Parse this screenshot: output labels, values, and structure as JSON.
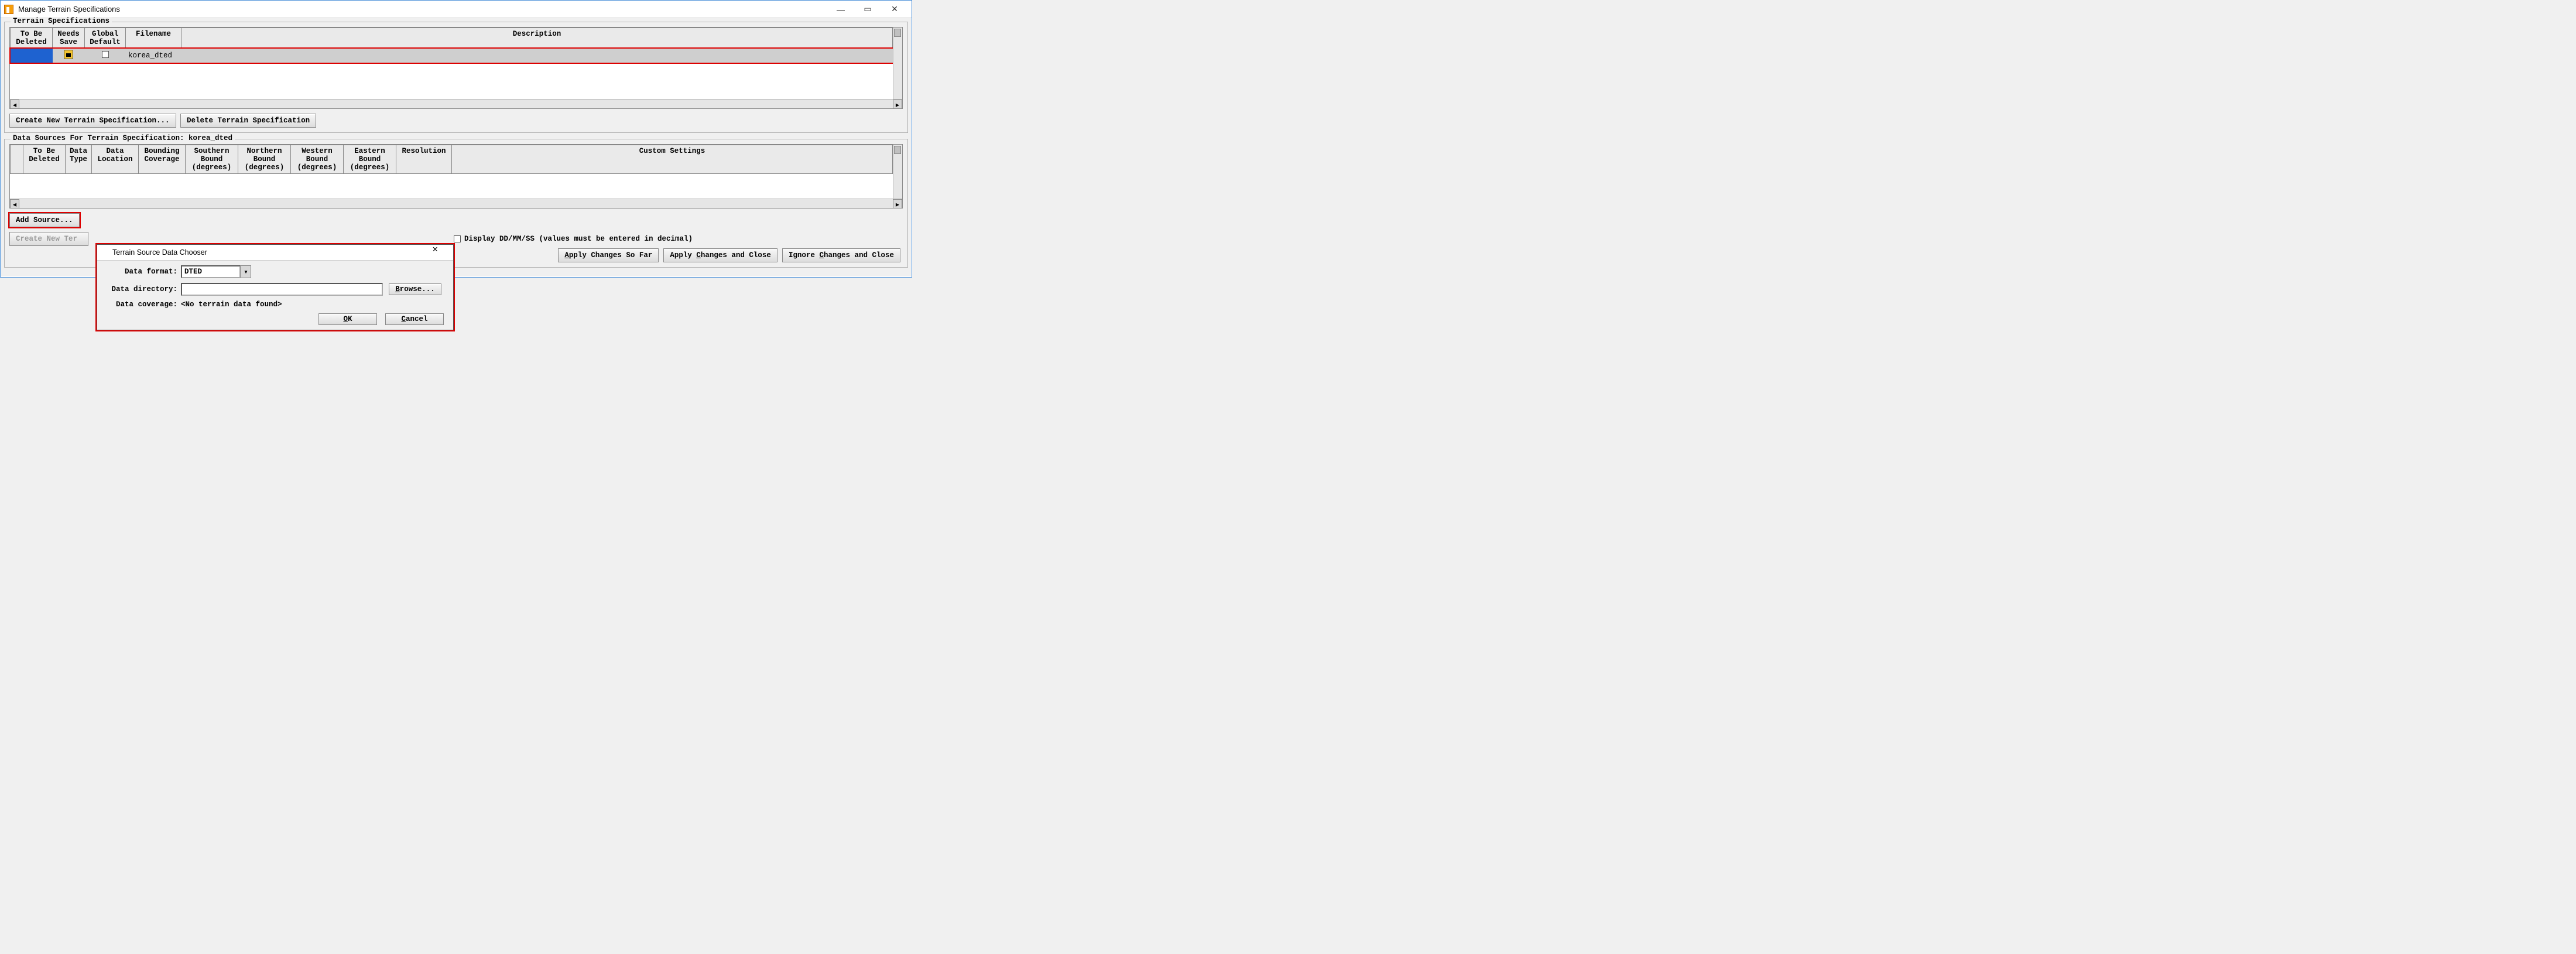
{
  "window": {
    "title": "Manage Terrain Specifications",
    "min_icon": "—",
    "max_icon": "▭",
    "close_icon": "✕"
  },
  "specs_group": {
    "legend": "Terrain Specifications",
    "headers": {
      "to_be_deleted": "To Be\nDeleted",
      "needs_save": "Needs\nSave",
      "global_default": "Global\nDefault",
      "filename": "Filename",
      "description": "Description"
    },
    "row": {
      "filename": "korea_dted",
      "description": ""
    },
    "btn_create": "Create New Terrain Specification...",
    "btn_delete": "Delete Terrain Specification"
  },
  "sources_group": {
    "legend": "Data Sources For Terrain Specification: korea_dted",
    "headers": {
      "spacer": "",
      "to_be_deleted": "To Be\nDeleted",
      "data_type": "Data\nType",
      "data_location": "Data\nLocation",
      "bounding_coverage": "Bounding\nCoverage",
      "southern": "Southern\nBound\n(degrees)",
      "northern": "Northern\nBound\n(degrees)",
      "western": "Western\nBound\n(degrees)",
      "eastern": "Eastern\nBound\n(degrees)",
      "resolution": "Resolution",
      "custom": "Custom Settings"
    },
    "btn_add": "Add Source...",
    "btn_create_disabled": "Create New Ter",
    "ddmmss_label": "Display DD/MM/SS (values must be entered in decimal)"
  },
  "footer": {
    "apply_so_far": "Apply Changes So Far",
    "apply_close": "Apply Changes and Close",
    "ignore_close": "Ignore Changes and Close",
    "underline": {
      "apply_so_far": "A",
      "apply_close": "C",
      "ignore_close": "C"
    }
  },
  "dialog": {
    "title": "Terrain Source Data Chooser",
    "close_icon": "✕",
    "format_label": "Data format:",
    "format_value": "DTED",
    "dir_label": "Data directory:",
    "dir_value": "",
    "browse": "Browse...",
    "coverage_label": "Data coverage:",
    "coverage_value": "<No terrain data found>",
    "ok": "OK",
    "cancel": "Cancel"
  }
}
